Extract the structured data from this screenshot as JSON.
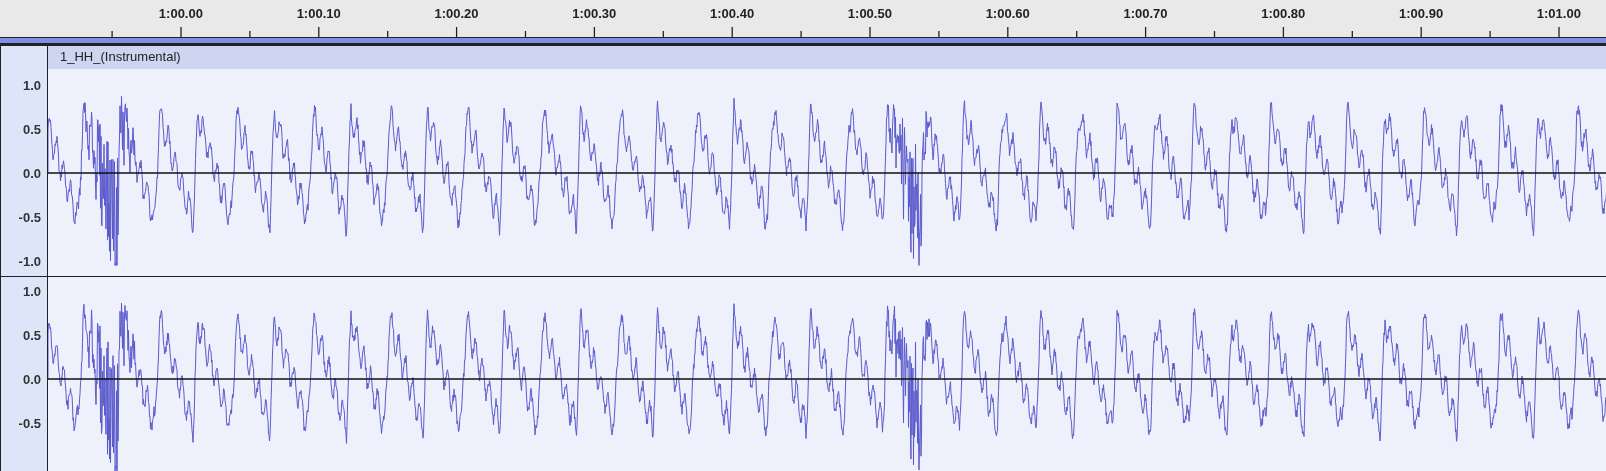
{
  "ruler": {
    "ticks": [
      "1:00.00",
      "1:00.10",
      "1:00.20",
      "1:00.30",
      "1:00.40",
      "1:00.50",
      "1:00.60",
      "1:00.70",
      "1:00.80",
      "1:00.90",
      "1:01.00"
    ]
  },
  "track": {
    "name": "1_HH_(Instrumental)",
    "channels": [
      {
        "axis_labels": [
          "1.0",
          "0.5",
          "0.0",
          "-0.5",
          "-1.0"
        ]
      },
      {
        "axis_labels": [
          "1.0",
          "0.5",
          "0.0",
          "-0.5"
        ]
      }
    ]
  }
}
